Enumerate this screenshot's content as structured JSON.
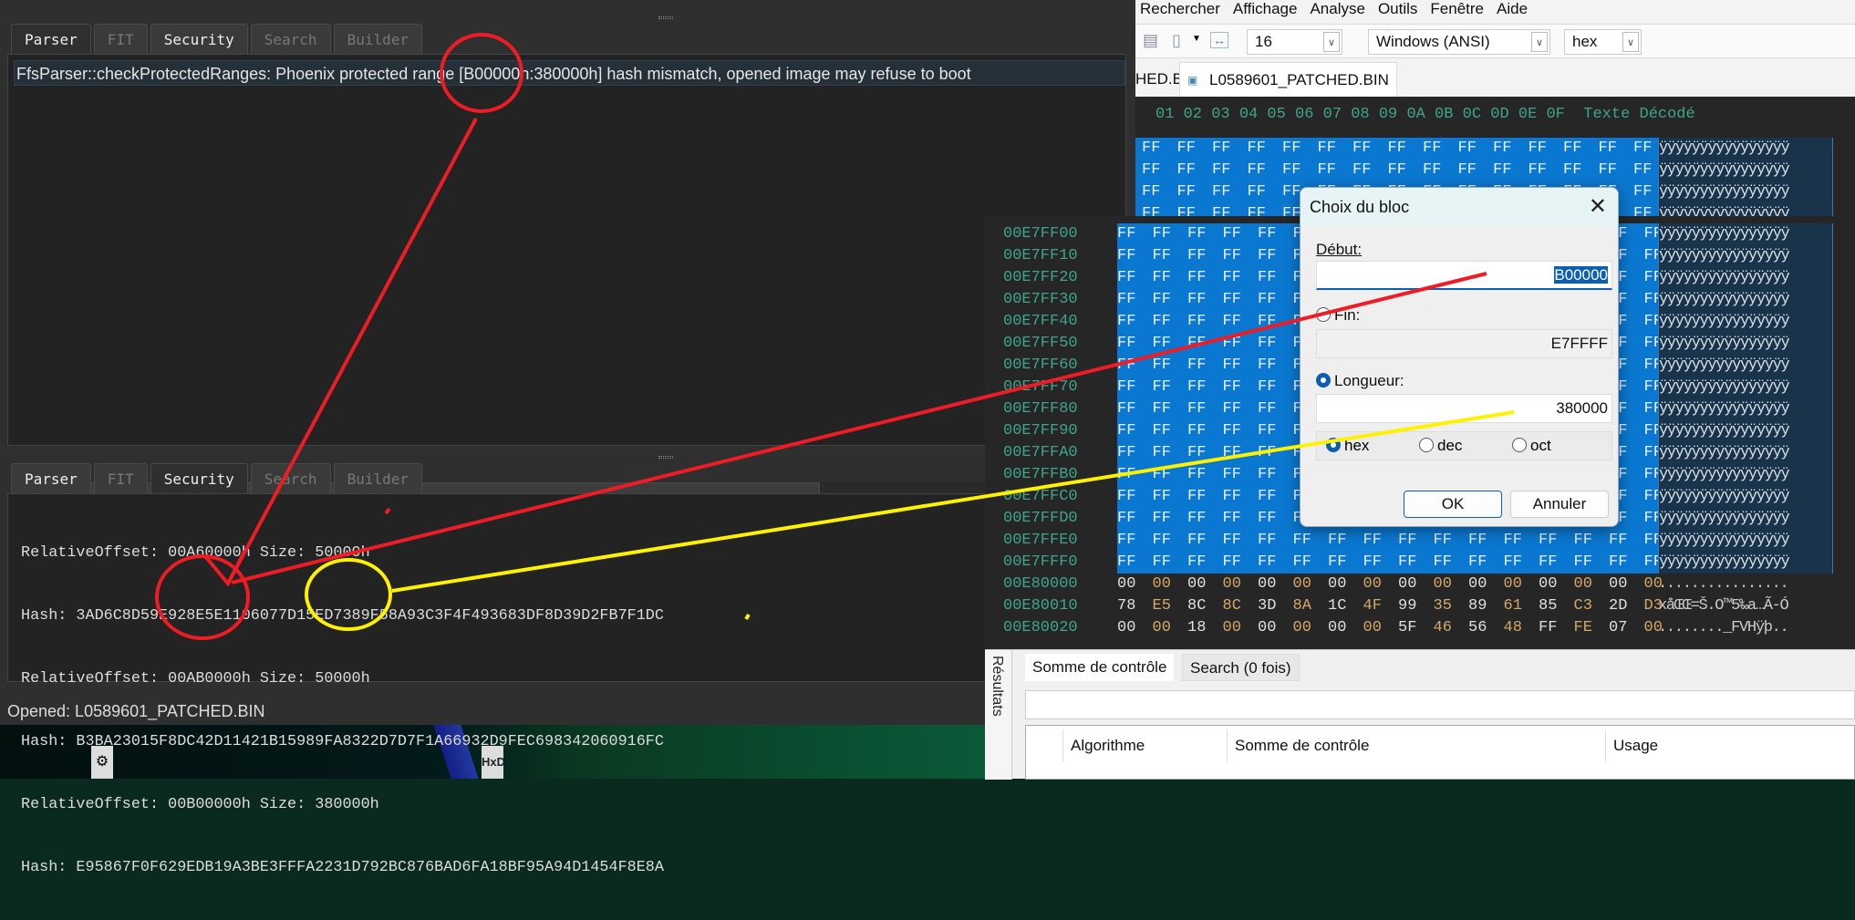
{
  "left_app": {
    "tabs": [
      "Parser",
      "FIT",
      "Security",
      "Search",
      "Builder"
    ],
    "log_message": "FfsParser::checkProtectedRanges: Phoenix protected range [B00000h:380000h] hash mismatch, opened image may refuse to boot",
    "security_lines": [
      "RelativeOffset: 00A60000h Size: 50000h",
      "Hash: 3AD6C8D59E928E5E1106077D15ED7389F58A93C3F4F493683DF8D39D2FB7F1DC",
      "RelativeOffset: 00AB0000h Size: 50000h",
      "Hash: B3BA23015F8DC42D11421B15989FA8322D7D7F1A66932D9FEC698342060916FC",
      "RelativeOffset: 00B00000h Size: 380000h",
      "Hash: E95867F0F629EDB19A3BE3FFFA2231D792BC876BAD6FA18BF95A94D1454F8E8A"
    ],
    "status": "Opened: L0589601_PATCHED.BIN"
  },
  "hex_editor": {
    "menu": [
      "Rechercher",
      "Affichage",
      "Analyse",
      "Outils",
      "Fenêtre",
      "Aide"
    ],
    "bytes_per_row": "16",
    "encoding": "Windows (ANSI)",
    "number_base": "hex",
    "file_tabs": [
      "HED.BIN",
      "L0589601_PATCHED.BIN"
    ],
    "header": "01 02 03 04 05 06 07 08 09 0A 0B 0C 0D 0E 0F  Texte Décodé",
    "top_rows": [
      {
        "bytes": "FF FF FF FF FF FF FF FF FF FF FF FF FF FF FF",
        "text": "ÿÿÿÿÿÿÿÿÿÿÿÿÿÿÿÿ"
      },
      {
        "bytes": "FF FF FF FF FF FF FF FF FF FF FF FF FF FF FF",
        "text": "ÿÿÿÿÿÿÿÿÿÿÿÿÿÿÿÿ"
      },
      {
        "bytes": "FF FF FF FF FF FF FF FF FF FF FF FF FF FF FF",
        "text": "ÿÿÿÿÿÿÿÿÿÿÿÿÿÿÿÿ"
      },
      {
        "bytes": "FF FF FF FF FF FF FF FF FF FF FF FF FF FF FF",
        "text": "ÿÿÿÿÿÿÿÿÿÿÿÿÿÿÿÿ"
      }
    ],
    "rows": [
      {
        "addr": "00E7FF00",
        "bytes": "FF FF FF FF FF FF FF FF FF FF FF FF FF FF FF FF",
        "text": "ÿÿÿÿÿÿÿÿÿÿÿÿÿÿÿÿ",
        "selected": true
      },
      {
        "addr": "00E7FF10",
        "bytes": "FF FF FF FF FF FF FF FF FF FF FF FF FF FF FF FF",
        "text": "ÿÿÿÿÿÿÿÿÿÿÿÿÿÿÿÿ",
        "selected": true
      },
      {
        "addr": "00E7FF20",
        "bytes": "FF FF FF FF FF FF FF FF FF FF FF FF FF FF FF FF",
        "text": "ÿÿÿÿÿÿÿÿÿÿÿÿÿÿÿÿ",
        "selected": true
      },
      {
        "addr": "00E7FF30",
        "bytes": "FF FF FF FF FF FF FF FF FF FF FF FF FF FF FF FF",
        "text": "ÿÿÿÿÿÿÿÿÿÿÿÿÿÿÿÿ",
        "selected": true
      },
      {
        "addr": "00E7FF40",
        "bytes": "FF FF FF FF FF FF FF FF FF FF FF FF FF FF FF FF",
        "text": "ÿÿÿÿÿÿÿÿÿÿÿÿÿÿÿÿ",
        "selected": true
      },
      {
        "addr": "00E7FF50",
        "bytes": "FF FF FF FF FF FF FF FF FF FF FF FF FF FF FF FF",
        "text": "ÿÿÿÿÿÿÿÿÿÿÿÿÿÿÿÿ",
        "selected": true
      },
      {
        "addr": "00E7FF60",
        "bytes": "FF FF FF FF FF FF FF FF FF FF FF FF FF FF FF FF",
        "text": "ÿÿÿÿÿÿÿÿÿÿÿÿÿÿÿÿ",
        "selected": true
      },
      {
        "addr": "00E7FF70",
        "bytes": "FF FF FF FF FF FF FF FF FF FF FF FF FF FF FF FF",
        "text": "ÿÿÿÿÿÿÿÿÿÿÿÿÿÿÿÿ",
        "selected": true
      },
      {
        "addr": "00E7FF80",
        "bytes": "FF FF FF FF FF FF FF FF FF FF FF FF FF FF FF FF",
        "text": "ÿÿÿÿÿÿÿÿÿÿÿÿÿÿÿÿ",
        "selected": true
      },
      {
        "addr": "00E7FF90",
        "bytes": "FF FF FF FF FF FF FF FF FF FF FF FF FF FF FF FF",
        "text": "ÿÿÿÿÿÿÿÿÿÿÿÿÿÿÿÿ",
        "selected": true
      },
      {
        "addr": "00E7FFA0",
        "bytes": "FF FF FF FF FF FF FF FF FF FF FF FF FF FF FF FF",
        "text": "ÿÿÿÿÿÿÿÿÿÿÿÿÿÿÿÿ",
        "selected": true
      },
      {
        "addr": "00E7FFB0",
        "bytes": "FF FF FF FF FF FF FF FF FF FF FF FF FF FF FF FF",
        "text": "ÿÿÿÿÿÿÿÿÿÿÿÿÿÿÿÿ",
        "selected": true
      },
      {
        "addr": "00E7FFC0",
        "bytes": "FF FF FF FF FF FF FF FF FF FF FF FF FF FF FF FF",
        "text": "ÿÿÿÿÿÿÿÿÿÿÿÿÿÿÿÿ",
        "selected": true
      },
      {
        "addr": "00E7FFD0",
        "bytes": "FF FF FF FF FF FF FF FF FF FF FF FF FF FF FF FF",
        "text": "ÿÿÿÿÿÿÿÿÿÿÿÿÿÿÿÿ",
        "selected": true
      },
      {
        "addr": "00E7FFE0",
        "bytes": "FF FF FF FF FF FF FF FF FF FF FF FF FF FF FF FF",
        "text": "ÿÿÿÿÿÿÿÿÿÿÿÿÿÿÿÿ",
        "selected": true
      },
      {
        "addr": "00E7FFF0",
        "bytes": "FF FF FF FF FF FF FF FF FF FF FF FF FF FF FF FF",
        "text": "ÿÿÿÿÿÿÿÿÿÿÿÿÿÿÿÿ",
        "selected": true
      },
      {
        "addr": "00E80000",
        "bytes": "00 00 00 00 00 00 00 00 00 00 00 00 00 00 00 00",
        "text": "................",
        "selected": false
      },
      {
        "addr": "00E80010",
        "bytes": "78 E5 8C 8C 3D 8A 1C 4F 99 35 89 61 85 C3 2D D3",
        "text": "xåŒŒ=Š.O™5‰a…Ã-Ó",
        "selected": false
      },
      {
        "addr": "00E80020",
        "bytes": "00 00 18 00 00 00 00 00 5F 46 56 48 FF FE 07 00",
        "text": "........_FVHÿþ..",
        "selected": false
      }
    ],
    "results": {
      "side_label": "Résultats",
      "tabs": [
        "Somme de contrôle",
        "Search (0 fois)"
      ],
      "columns": [
        "Algorithme",
        "Somme de contrôle",
        "Usage"
      ]
    }
  },
  "dialog": {
    "title": "Choix du bloc",
    "start_label": "Début:",
    "start_value": "B00000",
    "end_label": "Fin:",
    "end_value": "E7FFFF",
    "length_label": "Longueur:",
    "length_value": "380000",
    "bases": [
      "hex",
      "dec",
      "oct"
    ],
    "ok": "OK",
    "cancel": "Annuler"
  },
  "desktop": {
    "hxd_icon": "HxD"
  },
  "colors": {
    "selection": "#0a78d0",
    "address": "#3fa58a",
    "annot_red": "#ee1c24",
    "annot_yellow": "#fff200"
  }
}
